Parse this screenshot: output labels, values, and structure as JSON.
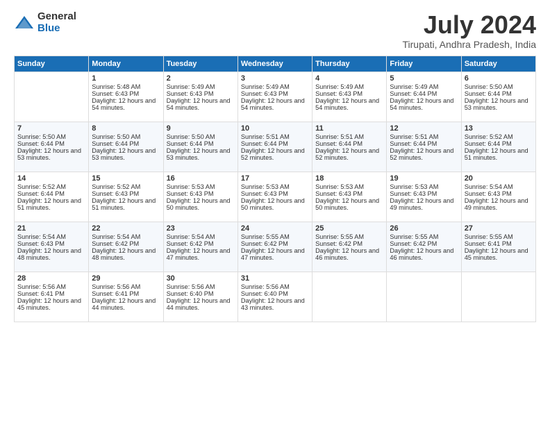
{
  "header": {
    "logo_general": "General",
    "logo_blue": "Blue",
    "title": "July 2024",
    "location": "Tirupati, Andhra Pradesh, India"
  },
  "weekdays": [
    "Sunday",
    "Monday",
    "Tuesday",
    "Wednesday",
    "Thursday",
    "Friday",
    "Saturday"
  ],
  "weeks": [
    [
      {
        "day": "",
        "empty": true
      },
      {
        "day": "1",
        "sunrise": "Sunrise: 5:48 AM",
        "sunset": "Sunset: 6:43 PM",
        "daylight": "Daylight: 12 hours and 54 minutes."
      },
      {
        "day": "2",
        "sunrise": "Sunrise: 5:49 AM",
        "sunset": "Sunset: 6:43 PM",
        "daylight": "Daylight: 12 hours and 54 minutes."
      },
      {
        "day": "3",
        "sunrise": "Sunrise: 5:49 AM",
        "sunset": "Sunset: 6:43 PM",
        "daylight": "Daylight: 12 hours and 54 minutes."
      },
      {
        "day": "4",
        "sunrise": "Sunrise: 5:49 AM",
        "sunset": "Sunset: 6:43 PM",
        "daylight": "Daylight: 12 hours and 54 minutes."
      },
      {
        "day": "5",
        "sunrise": "Sunrise: 5:49 AM",
        "sunset": "Sunset: 6:44 PM",
        "daylight": "Daylight: 12 hours and 54 minutes."
      },
      {
        "day": "6",
        "sunrise": "Sunrise: 5:50 AM",
        "sunset": "Sunset: 6:44 PM",
        "daylight": "Daylight: 12 hours and 53 minutes."
      }
    ],
    [
      {
        "day": "7",
        "sunrise": "Sunrise: 5:50 AM",
        "sunset": "Sunset: 6:44 PM",
        "daylight": "Daylight: 12 hours and 53 minutes."
      },
      {
        "day": "8",
        "sunrise": "Sunrise: 5:50 AM",
        "sunset": "Sunset: 6:44 PM",
        "daylight": "Daylight: 12 hours and 53 minutes."
      },
      {
        "day": "9",
        "sunrise": "Sunrise: 5:50 AM",
        "sunset": "Sunset: 6:44 PM",
        "daylight": "Daylight: 12 hours and 53 minutes."
      },
      {
        "day": "10",
        "sunrise": "Sunrise: 5:51 AM",
        "sunset": "Sunset: 6:44 PM",
        "daylight": "Daylight: 12 hours and 52 minutes."
      },
      {
        "day": "11",
        "sunrise": "Sunrise: 5:51 AM",
        "sunset": "Sunset: 6:44 PM",
        "daylight": "Daylight: 12 hours and 52 minutes."
      },
      {
        "day": "12",
        "sunrise": "Sunrise: 5:51 AM",
        "sunset": "Sunset: 6:44 PM",
        "daylight": "Daylight: 12 hours and 52 minutes."
      },
      {
        "day": "13",
        "sunrise": "Sunrise: 5:52 AM",
        "sunset": "Sunset: 6:44 PM",
        "daylight": "Daylight: 12 hours and 51 minutes."
      }
    ],
    [
      {
        "day": "14",
        "sunrise": "Sunrise: 5:52 AM",
        "sunset": "Sunset: 6:44 PM",
        "daylight": "Daylight: 12 hours and 51 minutes."
      },
      {
        "day": "15",
        "sunrise": "Sunrise: 5:52 AM",
        "sunset": "Sunset: 6:43 PM",
        "daylight": "Daylight: 12 hours and 51 minutes."
      },
      {
        "day": "16",
        "sunrise": "Sunrise: 5:53 AM",
        "sunset": "Sunset: 6:43 PM",
        "daylight": "Daylight: 12 hours and 50 minutes."
      },
      {
        "day": "17",
        "sunrise": "Sunrise: 5:53 AM",
        "sunset": "Sunset: 6:43 PM",
        "daylight": "Daylight: 12 hours and 50 minutes."
      },
      {
        "day": "18",
        "sunrise": "Sunrise: 5:53 AM",
        "sunset": "Sunset: 6:43 PM",
        "daylight": "Daylight: 12 hours and 50 minutes."
      },
      {
        "day": "19",
        "sunrise": "Sunrise: 5:53 AM",
        "sunset": "Sunset: 6:43 PM",
        "daylight": "Daylight: 12 hours and 49 minutes."
      },
      {
        "day": "20",
        "sunrise": "Sunrise: 5:54 AM",
        "sunset": "Sunset: 6:43 PM",
        "daylight": "Daylight: 12 hours and 49 minutes."
      }
    ],
    [
      {
        "day": "21",
        "sunrise": "Sunrise: 5:54 AM",
        "sunset": "Sunset: 6:43 PM",
        "daylight": "Daylight: 12 hours and 48 minutes."
      },
      {
        "day": "22",
        "sunrise": "Sunrise: 5:54 AM",
        "sunset": "Sunset: 6:42 PM",
        "daylight": "Daylight: 12 hours and 48 minutes."
      },
      {
        "day": "23",
        "sunrise": "Sunrise: 5:54 AM",
        "sunset": "Sunset: 6:42 PM",
        "daylight": "Daylight: 12 hours and 47 minutes."
      },
      {
        "day": "24",
        "sunrise": "Sunrise: 5:55 AM",
        "sunset": "Sunset: 6:42 PM",
        "daylight": "Daylight: 12 hours and 47 minutes."
      },
      {
        "day": "25",
        "sunrise": "Sunrise: 5:55 AM",
        "sunset": "Sunset: 6:42 PM",
        "daylight": "Daylight: 12 hours and 46 minutes."
      },
      {
        "day": "26",
        "sunrise": "Sunrise: 5:55 AM",
        "sunset": "Sunset: 6:42 PM",
        "daylight": "Daylight: 12 hours and 46 minutes."
      },
      {
        "day": "27",
        "sunrise": "Sunrise: 5:55 AM",
        "sunset": "Sunset: 6:41 PM",
        "daylight": "Daylight: 12 hours and 45 minutes."
      }
    ],
    [
      {
        "day": "28",
        "sunrise": "Sunrise: 5:56 AM",
        "sunset": "Sunset: 6:41 PM",
        "daylight": "Daylight: 12 hours and 45 minutes."
      },
      {
        "day": "29",
        "sunrise": "Sunrise: 5:56 AM",
        "sunset": "Sunset: 6:41 PM",
        "daylight": "Daylight: 12 hours and 44 minutes."
      },
      {
        "day": "30",
        "sunrise": "Sunrise: 5:56 AM",
        "sunset": "Sunset: 6:40 PM",
        "daylight": "Daylight: 12 hours and 44 minutes."
      },
      {
        "day": "31",
        "sunrise": "Sunrise: 5:56 AM",
        "sunset": "Sunset: 6:40 PM",
        "daylight": "Daylight: 12 hours and 43 minutes."
      },
      {
        "day": "",
        "empty": true
      },
      {
        "day": "",
        "empty": true
      },
      {
        "day": "",
        "empty": true
      }
    ]
  ]
}
